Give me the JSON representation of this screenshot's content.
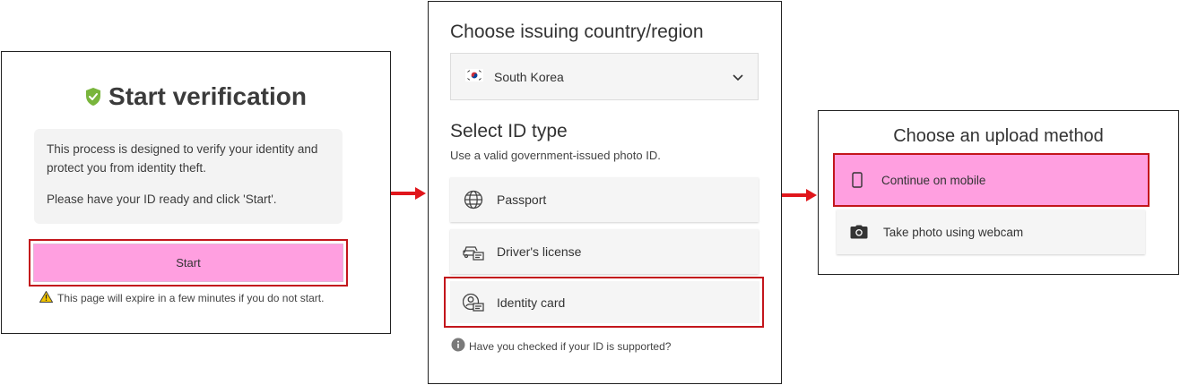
{
  "step1": {
    "title": "Start verification",
    "info_line1": "This process is designed to verify your identity and protect you from identity theft.",
    "info_line2": "Please have your ID ready and click 'Start'.",
    "start_label": "Start",
    "expire_note": "This page will expire in a few minutes if you do not start."
  },
  "step2": {
    "country_heading": "Choose issuing country/region",
    "country_value": "South Korea",
    "id_heading": "Select ID type",
    "id_subtitle": "Use a valid government-issued photo ID.",
    "options": [
      {
        "label": "Passport",
        "icon": "globe-icon"
      },
      {
        "label": "Driver's license",
        "icon": "car-license-icon"
      },
      {
        "label": "Identity card",
        "icon": "id-card-icon"
      }
    ],
    "help_link": "Have you checked if your ID is supported?"
  },
  "step3": {
    "title": "Choose an upload method",
    "options": [
      {
        "label": "Continue on mobile",
        "icon": "mobile-phone-icon"
      },
      {
        "label": "Take photo using webcam",
        "icon": "camera-icon"
      }
    ]
  },
  "colors": {
    "highlight_fill": "#ff9fe0",
    "highlight_border": "#c3161c",
    "arrow": "#e0161b",
    "shield": "#79b53c"
  }
}
